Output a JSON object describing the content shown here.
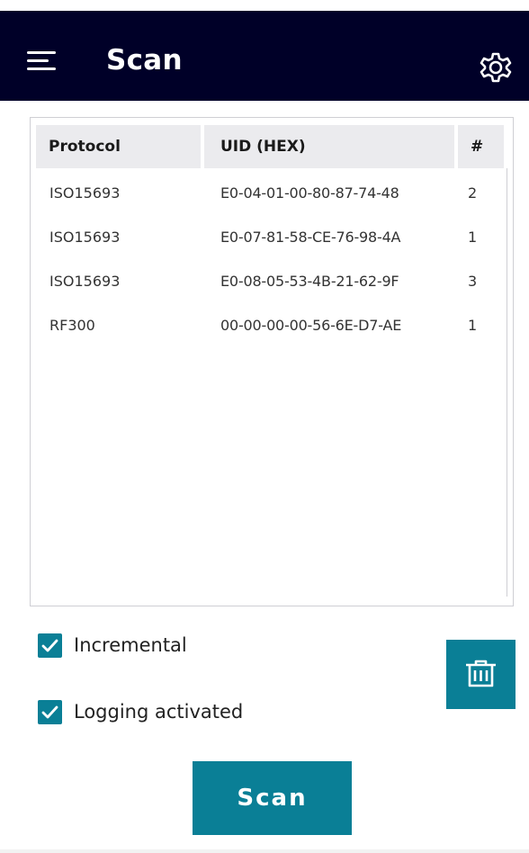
{
  "header": {
    "title": "Scan",
    "menu_icon": "hamburger-menu-icon",
    "settings_icon": "gear-icon",
    "background_color": "#000028"
  },
  "table": {
    "columns": [
      "Protocol",
      "UID (HEX)",
      "#"
    ],
    "rows": [
      {
        "protocol": "ISO15693",
        "uid": "E0-04-01-00-80-87-74-48",
        "count": "2"
      },
      {
        "protocol": "ISO15693",
        "uid": "E0-07-81-58-CE-76-98-4A",
        "count": "1"
      },
      {
        "protocol": "ISO15693",
        "uid": "E0-08-05-53-4B-21-62-9F",
        "count": "3"
      },
      {
        "protocol": "RF300",
        "uid": "00-00-00-00-56-6E-D7-AE",
        "count": "1"
      }
    ]
  },
  "options": {
    "incremental": {
      "label": "Incremental",
      "checked": true
    },
    "logging": {
      "label": "Logging activated",
      "checked": true
    }
  },
  "actions": {
    "delete_icon": "trash-icon",
    "scan_label": "Scan",
    "accent_color": "#0a7f96"
  }
}
